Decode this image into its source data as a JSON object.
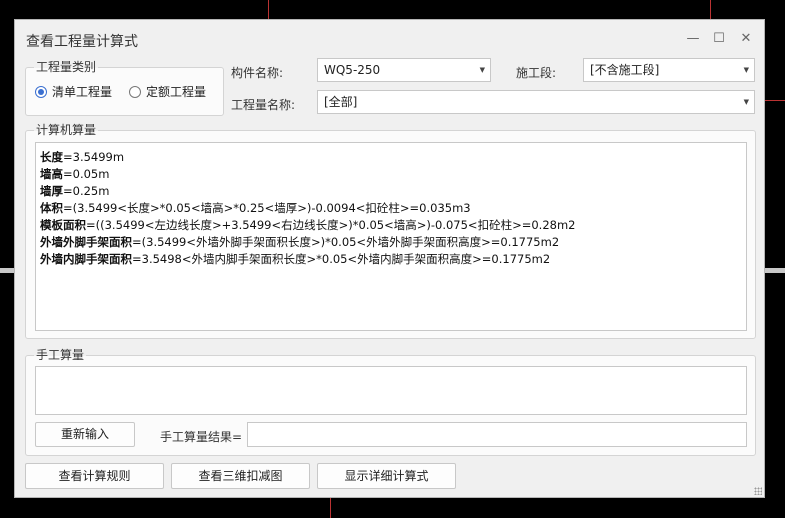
{
  "window": {
    "title": "查看工程量计算式"
  },
  "window_buttons": {
    "minimize": "—",
    "maximize": "☐",
    "close": "✕"
  },
  "quantity_type": {
    "label": "工程量类别",
    "options": [
      {
        "label": "清单工程量",
        "selected": true
      },
      {
        "label": "定额工程量",
        "selected": false
      }
    ]
  },
  "fields": {
    "component_label": "构件名称:",
    "component_value": "WQ5-250",
    "section_label": "施工段:",
    "section_value": "[不含施工段]",
    "quantity_name_label": "工程量名称:",
    "quantity_name_value": "[全部]"
  },
  "computer_calc": {
    "label": "计算机算量",
    "lines": [
      {
        "name": "长度",
        "expr": "=3.5499m"
      },
      {
        "name": "墙高",
        "expr": "=0.05m"
      },
      {
        "name": "墙厚",
        "expr": "=0.25m"
      },
      {
        "name": "体积",
        "expr": "=(3.5499<长度>*0.05<墙高>*0.25<墙厚>)-0.0094<扣砼柱>=0.035m3"
      },
      {
        "name": "模板面积",
        "expr": "=((3.5499<左边线长度>+3.5499<右边线长度>)*0.05<墙高>)-0.075<扣砼柱>=0.28m2"
      },
      {
        "name": "外墙外脚手架面积",
        "expr": "=(3.5499<外墙外脚手架面积长度>)*0.05<外墙外脚手架面积高度>=0.1775m2"
      },
      {
        "name": "外墙内脚手架面积",
        "expr": "=3.5498<外墙内脚手架面积长度>*0.05<外墙内脚手架面积高度>=0.1775m2"
      }
    ]
  },
  "manual_calc": {
    "label": "手工算量",
    "reenter_button": "重新输入",
    "result_label": "手工算量结果=",
    "result_value": ""
  },
  "bottom_buttons": {
    "rules": "查看计算规则",
    "view3d": "查看三维扣减图",
    "details": "显示详细计算式"
  }
}
